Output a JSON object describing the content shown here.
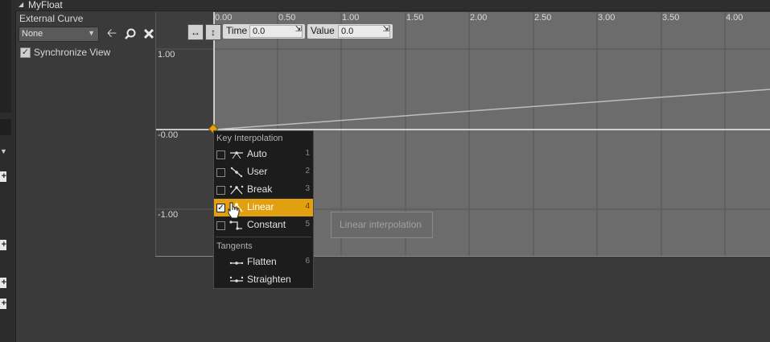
{
  "header": {
    "title": "MyFloat"
  },
  "left_panel": {
    "external_curve_label": "External Curve",
    "curve_value": "None",
    "icons": [
      "back-arrow-icon",
      "search-icon",
      "close-icon"
    ],
    "sync_label": "Synchronize View",
    "sync_checked": true
  },
  "graph": {
    "x_ticks": [
      "0.00",
      "0.50",
      "1.00",
      "1.50",
      "2.00",
      "2.50",
      "3.00",
      "3.50",
      "4.00"
    ],
    "y_ticks": [
      "1.00",
      "-0.00",
      "-1.00"
    ],
    "toolbar": {
      "time_label": "Time",
      "time_value": "0.0",
      "value_label": "Value",
      "value_value": "0.0"
    },
    "key_color": "#e0a010"
  },
  "context_menu": {
    "section_interpolation": "Key Interpolation",
    "items": [
      {
        "label": "Auto",
        "key": "1",
        "checked": false
      },
      {
        "label": "User",
        "key": "2",
        "checked": false
      },
      {
        "label": "Break",
        "key": "3",
        "checked": false
      },
      {
        "label": "Linear",
        "key": "4",
        "checked": true
      },
      {
        "label": "Constant",
        "key": "5",
        "checked": false
      }
    ],
    "section_tangents": "Tangents",
    "tangents": [
      {
        "label": "Flatten",
        "key": "6"
      },
      {
        "label": "Straighten",
        "key": ""
      }
    ]
  },
  "tooltip": {
    "text": "Linear interpolation"
  }
}
